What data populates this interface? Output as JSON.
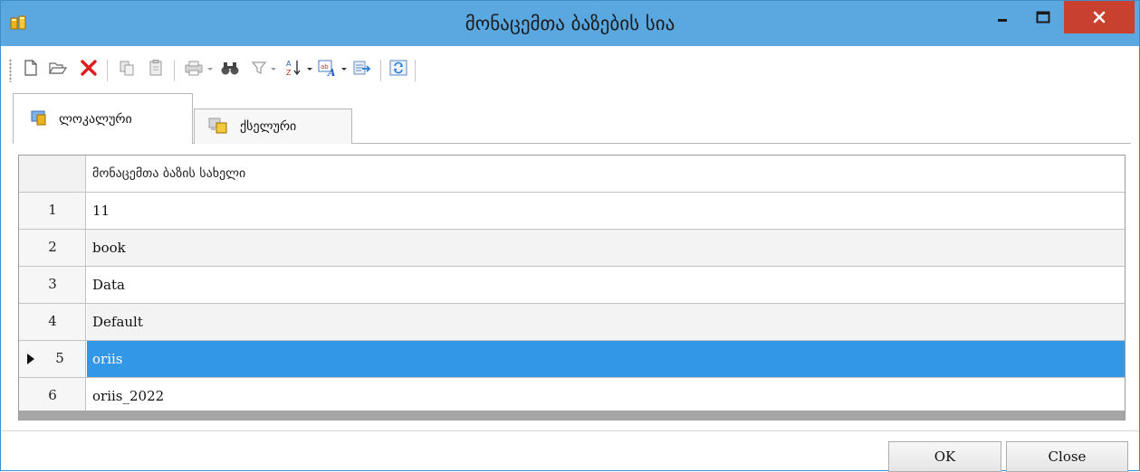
{
  "window": {
    "title": "მონაცემთა ბაზების სია",
    "icons": {
      "app": "app-database-icon",
      "minimize": "minimize-icon",
      "maximize": "maximize-icon",
      "close": "close-icon"
    }
  },
  "toolbar": {
    "items": [
      {
        "name": "new-icon"
      },
      {
        "name": "open-folder-icon"
      },
      {
        "name": "delete-icon"
      },
      {
        "name": "copy-icon"
      },
      {
        "name": "paste-icon"
      },
      {
        "name": "print-icon"
      },
      {
        "name": "find-binoculars-icon"
      },
      {
        "name": "filter-icon"
      },
      {
        "name": "sort-az-icon"
      },
      {
        "name": "text-format-icon"
      },
      {
        "name": "export-icon"
      },
      {
        "name": "refresh-icon"
      }
    ]
  },
  "tabs": [
    {
      "label": "ლოკალური",
      "icon": "local-database-icon",
      "active": true
    },
    {
      "label": "ქსელური",
      "icon": "network-database-icon",
      "active": false
    }
  ],
  "grid": {
    "header": "მონაცემთა ბაზის სახელი",
    "rows": [
      {
        "num": "1",
        "name": "11"
      },
      {
        "num": "2",
        "name": "book"
      },
      {
        "num": "3",
        "name": "Data"
      },
      {
        "num": "4",
        "name": "Default"
      },
      {
        "num": "5",
        "name": "oriis",
        "selected": true
      },
      {
        "num": "6",
        "name": "oriis_2022"
      }
    ]
  },
  "buttons": {
    "ok": "OK",
    "cancel": "Close"
  },
  "colors": {
    "titlebar": "#5ba8e0",
    "close": "#c8412f",
    "selection": "#3397e8"
  }
}
